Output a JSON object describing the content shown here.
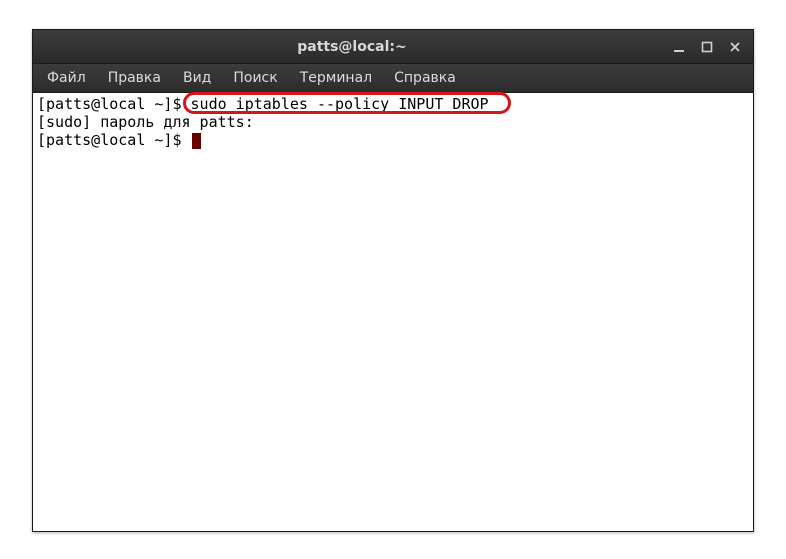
{
  "window": {
    "title": "patts@local:~"
  },
  "menubar": {
    "items": [
      "Файл",
      "Правка",
      "Вид",
      "Поиск",
      "Терминал",
      "Справка"
    ]
  },
  "terminal": {
    "lines": [
      {
        "prompt": "[patts@local ~]$ ",
        "command": "sudo iptables --policy INPUT DROP"
      },
      {
        "text": "[sudo] пароль для patts:"
      },
      {
        "prompt": "[patts@local ~]$ ",
        "hasCursor": true
      }
    ]
  },
  "colors": {
    "callout_border": "#d2161a",
    "cursor": "#690000"
  }
}
